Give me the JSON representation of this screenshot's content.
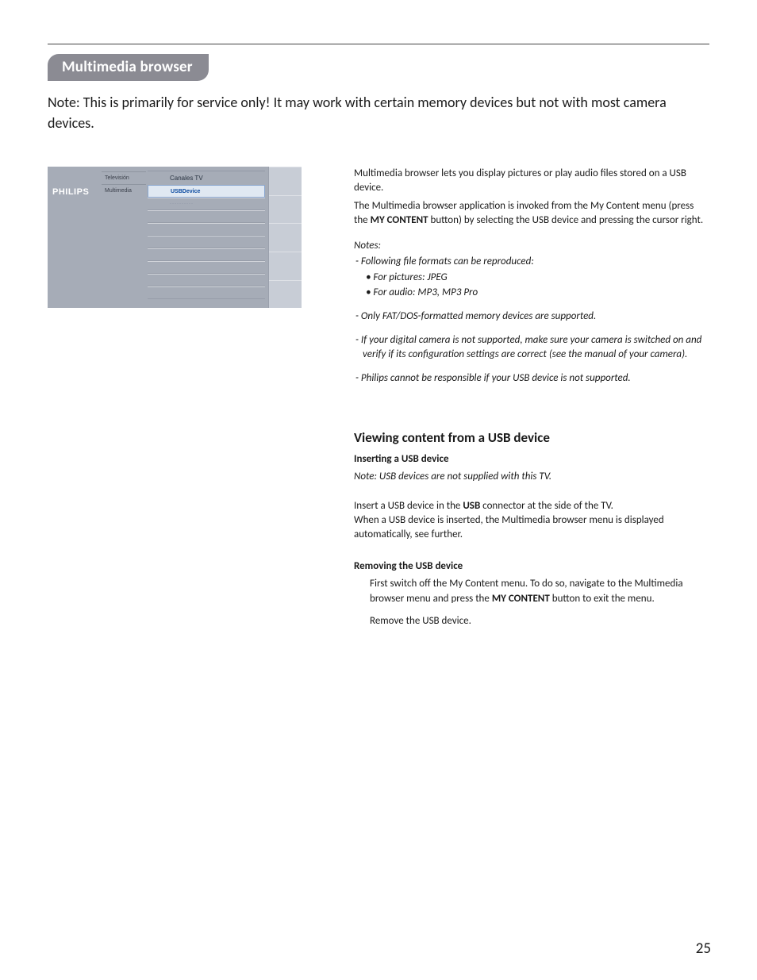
{
  "section_title": "Multimedia browser",
  "lead": "Note: This is primarily for service only!  It may work with certain memory devices but not with most camera devices.",
  "mock": {
    "brand": "PHILIPS",
    "col1": [
      "Televisión",
      "Multimedia"
    ],
    "col2_head": "Canales TV",
    "col2_selected": "USBDevice",
    "col2_faint": "··········"
  },
  "intro_p1": "Multimedia browser lets you display pictures or play audio files stored on a USB device.",
  "intro_p2_a": "The Multimedia browser application is invoked from the My Content menu (press the ",
  "intro_p2_bold": "MY CONTENT",
  "intro_p2_b": " button) by selecting the USB device and pressing the cursor right.",
  "notes_label": "Notes:",
  "note1": "- Following file formats can be reproduced:",
  "note1a": "• For pictures: JPEG",
  "note1b": "• For audio: MP3, MP3 Pro",
  "note2": "- Only FAT/DOS-formatted memory devices are supported.",
  "note3": "- If your digital camera is not supported, make sure your camera is switched on and verify if its configuration settings are correct (see the manual of your camera).",
  "note4": "- Philips cannot be responsible if your USB device is not supported.",
  "h2": "Viewing content from a USB device",
  "h3a": "Inserting a USB device",
  "h3a_note": "Note: USB devices are not supplied with this TV.",
  "h3a_p1_a": "Insert a USB device in the ",
  "h3a_p1_bold": "USB",
  "h3a_p1_b": " connector at the side of the TV.",
  "h3a_p2": "When a USB device is inserted, the Multimedia browser menu is displayed automatically, see further.",
  "h3b": "Removing the USB device",
  "h3b_p1_a": "First switch off the My Content menu. To do so, navigate to the Multimedia browser menu and press the ",
  "h3b_p1_bold": "MY CONTENT",
  "h3b_p1_b": " button to exit the menu.",
  "h3b_p2": "Remove the USB device.",
  "page_number": "25"
}
